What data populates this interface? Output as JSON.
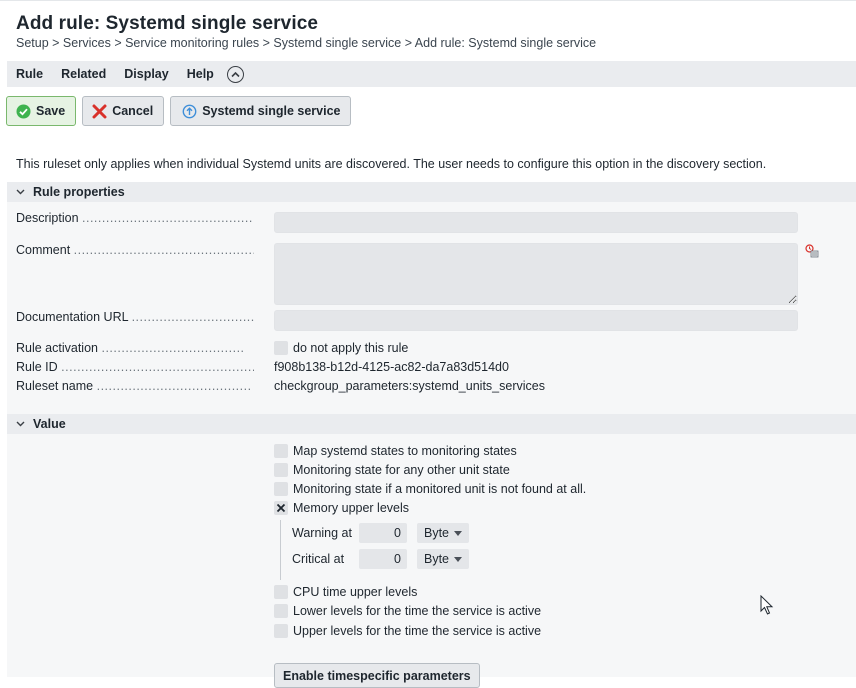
{
  "page": {
    "title": "Add rule: Systemd single service",
    "breadcrumb": "Setup > Services > Service monitoring rules > Systemd single service > Add rule: Systemd single service"
  },
  "menu": {
    "items": [
      "Rule",
      "Related",
      "Display",
      "Help"
    ]
  },
  "toolbar": {
    "save_label": "Save",
    "cancel_label": "Cancel",
    "ruleset_label": "Systemd single service"
  },
  "info_text": "This ruleset only applies when individual Systemd units are discovered. The user needs to configure this option in the discovery section.",
  "rule_properties": {
    "header": "Rule properties",
    "description_label": "Description",
    "description_value": "",
    "comment_label": "Comment",
    "comment_value": "",
    "doc_url_label": "Documentation URL",
    "doc_url_value": "",
    "activation_label": "Rule activation",
    "activation_option": "do not apply this rule",
    "rule_id_label": "Rule ID",
    "rule_id_value": "f908b138-b12d-4125-ac82-da7a83d514d0",
    "ruleset_name_label": "Ruleset name",
    "ruleset_name_value": "checkgroup_parameters:systemd_units_services"
  },
  "value_section": {
    "header": "Value",
    "options": {
      "map_states": "Map systemd states to monitoring states",
      "other_state": "Monitoring state for any other unit state",
      "not_found": "Monitoring state if a monitored unit is not found at all.",
      "memory": "Memory upper levels",
      "cpu": "CPU time upper levels",
      "lower_levels": "Lower levels for the time the service is active",
      "upper_levels": "Upper levels for the time the service is active"
    },
    "memory": {
      "warning_label": "Warning at",
      "warning_value": "0",
      "warning_unit": "Byte",
      "critical_label": "Critical at",
      "critical_value": "0",
      "critical_unit": "Byte"
    },
    "timespecific_button": "Enable timespecific parameters"
  },
  "colors": {
    "save_green": "#3fb34f",
    "cancel_red": "#d9312b",
    "info_blue": "#3f8fd9"
  }
}
